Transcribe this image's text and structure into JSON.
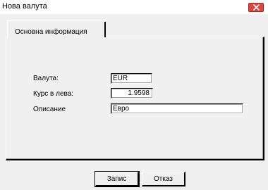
{
  "window": {
    "title": "Нова валута",
    "close_icon": "close-icon"
  },
  "tabs": [
    {
      "label": "Основна информация",
      "active": true
    }
  ],
  "form": {
    "currency_label": "Валута:",
    "currency_value": "EUR",
    "rate_label": "Курс в лева:",
    "rate_value": "1.9598",
    "description_label": "Описание",
    "description_value": "Евро"
  },
  "buttons": {
    "save_label": "Запис",
    "cancel_label": "Отказ"
  },
  "colors": {
    "background": "#f0f0f0",
    "close_button": "#d9473f",
    "input_background": "#ffffff"
  }
}
